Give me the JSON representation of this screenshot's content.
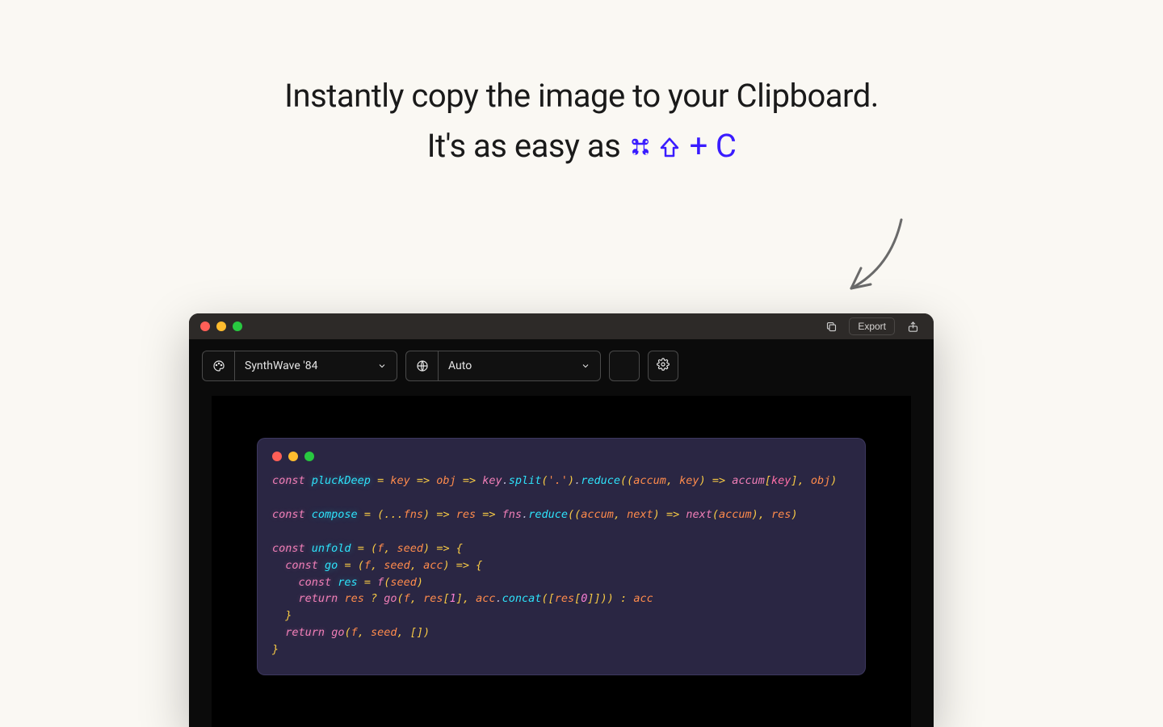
{
  "headline": {
    "line1": "Instantly copy the image to your Clipboard.",
    "line2_prefix": "It's as easy as ",
    "shortcut_keys": [
      "⌘",
      "⇧",
      "+",
      "C"
    ]
  },
  "titlebar": {
    "export_label": "Export"
  },
  "toolbar": {
    "theme_selected": "SynthWave '84",
    "language_selected": "Auto"
  },
  "code": {
    "tokens": [
      {
        "blank": true
      },
      [
        {
          "t": "const",
          "c": "kw"
        },
        {
          "t": " "
        },
        {
          "t": "pluckDeep",
          "c": "fn"
        },
        {
          "t": " "
        },
        {
          "t": "=",
          "c": "op"
        },
        {
          "t": " "
        },
        {
          "t": "key",
          "c": "var"
        },
        {
          "t": " "
        },
        {
          "t": "=>",
          "c": "op"
        },
        {
          "t": " "
        },
        {
          "t": "obj",
          "c": "var"
        },
        {
          "t": " "
        },
        {
          "t": "=>",
          "c": "op"
        },
        {
          "t": " "
        },
        {
          "t": "key",
          "c": "obj"
        },
        {
          "t": "."
        },
        {
          "t": "split",
          "c": "method"
        },
        {
          "t": "(",
          "c": "punc"
        },
        {
          "t": "'.'",
          "c": "str"
        },
        {
          "t": ")",
          "c": "punc"
        },
        {
          "t": "."
        },
        {
          "t": "reduce",
          "c": "method"
        },
        {
          "t": "((",
          "c": "punc"
        },
        {
          "t": "accum",
          "c": "var"
        },
        {
          "t": ", ",
          "c": "punc"
        },
        {
          "t": "key",
          "c": "var"
        },
        {
          "t": ")",
          "c": "punc"
        },
        {
          "t": " "
        },
        {
          "t": "=>",
          "c": "op"
        },
        {
          "t": " "
        },
        {
          "t": "accum",
          "c": "obj"
        },
        {
          "t": "[",
          "c": "punc"
        },
        {
          "t": "key",
          "c": "param2"
        },
        {
          "t": "]",
          "c": "punc"
        },
        {
          "t": ", ",
          "c": "punc"
        },
        {
          "t": "obj",
          "c": "var"
        },
        {
          "t": ")",
          "c": "punc"
        }
      ],
      {
        "blank": true
      },
      [
        {
          "t": "const",
          "c": "kw"
        },
        {
          "t": " "
        },
        {
          "t": "compose",
          "c": "fn"
        },
        {
          "t": " "
        },
        {
          "t": "=",
          "c": "op"
        },
        {
          "t": " "
        },
        {
          "t": "(",
          "c": "punc"
        },
        {
          "t": "...",
          "c": "op"
        },
        {
          "t": "fns",
          "c": "var"
        },
        {
          "t": ")",
          "c": "punc"
        },
        {
          "t": " "
        },
        {
          "t": "=>",
          "c": "op"
        },
        {
          "t": " "
        },
        {
          "t": "res",
          "c": "var"
        },
        {
          "t": " "
        },
        {
          "t": "=>",
          "c": "op"
        },
        {
          "t": " "
        },
        {
          "t": "fns",
          "c": "obj"
        },
        {
          "t": "."
        },
        {
          "t": "reduce",
          "c": "method"
        },
        {
          "t": "((",
          "c": "punc"
        },
        {
          "t": "accum",
          "c": "var"
        },
        {
          "t": ", ",
          "c": "punc"
        },
        {
          "t": "next",
          "c": "var"
        },
        {
          "t": ")",
          "c": "punc"
        },
        {
          "t": " "
        },
        {
          "t": "=>",
          "c": "op"
        },
        {
          "t": " "
        },
        {
          "t": "next",
          "c": "obj"
        },
        {
          "t": "(",
          "c": "punc"
        },
        {
          "t": "accum",
          "c": "var"
        },
        {
          "t": ")",
          "c": "punc"
        },
        {
          "t": ", ",
          "c": "punc"
        },
        {
          "t": "res",
          "c": "var"
        },
        {
          "t": ")",
          "c": "punc"
        }
      ],
      {
        "blank": true
      },
      [
        {
          "t": "const",
          "c": "kw"
        },
        {
          "t": " "
        },
        {
          "t": "unfold",
          "c": "fn"
        },
        {
          "t": " "
        },
        {
          "t": "=",
          "c": "op"
        },
        {
          "t": " "
        },
        {
          "t": "(",
          "c": "punc"
        },
        {
          "t": "f",
          "c": "var"
        },
        {
          "t": ", ",
          "c": "punc"
        },
        {
          "t": "seed",
          "c": "var"
        },
        {
          "t": ")",
          "c": "punc"
        },
        {
          "t": " "
        },
        {
          "t": "=>",
          "c": "op"
        },
        {
          "t": " "
        },
        {
          "t": "{",
          "c": "punc"
        }
      ],
      [
        {
          "t": "  "
        },
        {
          "t": "const",
          "c": "kw"
        },
        {
          "t": " "
        },
        {
          "t": "go",
          "c": "fn"
        },
        {
          "t": " "
        },
        {
          "t": "=",
          "c": "op"
        },
        {
          "t": " "
        },
        {
          "t": "(",
          "c": "punc"
        },
        {
          "t": "f",
          "c": "var"
        },
        {
          "t": ", ",
          "c": "punc"
        },
        {
          "t": "seed",
          "c": "var"
        },
        {
          "t": ", ",
          "c": "punc"
        },
        {
          "t": "acc",
          "c": "var"
        },
        {
          "t": ")",
          "c": "punc"
        },
        {
          "t": " "
        },
        {
          "t": "=>",
          "c": "op"
        },
        {
          "t": " "
        },
        {
          "t": "{",
          "c": "punc"
        }
      ],
      [
        {
          "t": "    "
        },
        {
          "t": "const",
          "c": "kw"
        },
        {
          "t": " "
        },
        {
          "t": "res",
          "c": "fn"
        },
        {
          "t": " "
        },
        {
          "t": "=",
          "c": "op"
        },
        {
          "t": " "
        },
        {
          "t": "f",
          "c": "obj"
        },
        {
          "t": "(",
          "c": "punc"
        },
        {
          "t": "seed",
          "c": "var"
        },
        {
          "t": ")",
          "c": "punc"
        }
      ],
      [
        {
          "t": "    "
        },
        {
          "t": "return",
          "c": "kw"
        },
        {
          "t": " "
        },
        {
          "t": "res",
          "c": "var"
        },
        {
          "t": " "
        },
        {
          "t": "?",
          "c": "op"
        },
        {
          "t": " "
        },
        {
          "t": "go",
          "c": "obj"
        },
        {
          "t": "(",
          "c": "punc"
        },
        {
          "t": "f",
          "c": "var"
        },
        {
          "t": ", ",
          "c": "punc"
        },
        {
          "t": "res",
          "c": "var"
        },
        {
          "t": "[",
          "c": "punc"
        },
        {
          "t": "1",
          "c": "num"
        },
        {
          "t": "]",
          "c": "punc"
        },
        {
          "t": ", ",
          "c": "punc"
        },
        {
          "t": "acc",
          "c": "var"
        },
        {
          "t": "."
        },
        {
          "t": "concat",
          "c": "method"
        },
        {
          "t": "([",
          "c": "punc"
        },
        {
          "t": "res",
          "c": "var"
        },
        {
          "t": "[",
          "c": "punc"
        },
        {
          "t": "0",
          "c": "num"
        },
        {
          "t": "]]))",
          "c": "punc"
        },
        {
          "t": " "
        },
        {
          "t": ":",
          "c": "op"
        },
        {
          "t": " "
        },
        {
          "t": "acc",
          "c": "var"
        }
      ],
      [
        {
          "t": "  "
        },
        {
          "t": "}",
          "c": "punc"
        }
      ],
      [
        {
          "t": "  "
        },
        {
          "t": "return",
          "c": "kw"
        },
        {
          "t": " "
        },
        {
          "t": "go",
          "c": "obj"
        },
        {
          "t": "(",
          "c": "punc"
        },
        {
          "t": "f",
          "c": "var"
        },
        {
          "t": ", ",
          "c": "punc"
        },
        {
          "t": "seed",
          "c": "var"
        },
        {
          "t": ", ",
          "c": "punc"
        },
        {
          "t": "[]",
          "c": "punc"
        },
        {
          "t": ")",
          "c": "punc"
        }
      ],
      [
        {
          "t": "}",
          "c": "punc"
        }
      ]
    ]
  }
}
